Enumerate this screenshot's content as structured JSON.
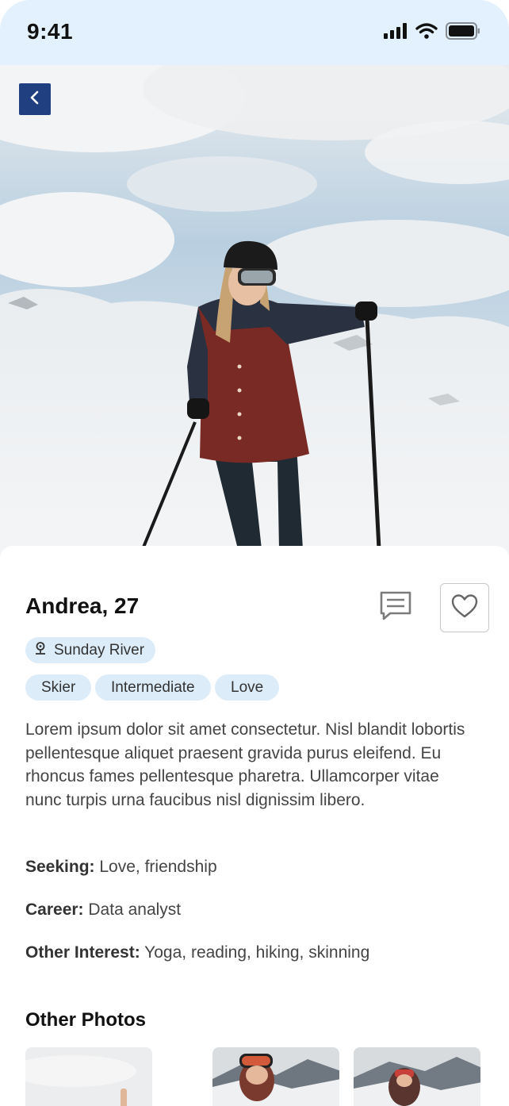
{
  "status_bar": {
    "time": "9:41",
    "icons": [
      "signal-icon",
      "wifi-icon",
      "battery-icon"
    ]
  },
  "hero": {
    "photo": "skier-in-snow-photo",
    "back_icon": "chevron-left-icon"
  },
  "profile": {
    "name": "Andrea, 27",
    "location": "Sunday River",
    "tags": [
      "Skier",
      "Intermediate",
      "Love"
    ],
    "bio": "Lorem ipsum dolor sit amet consectetur. Nisl blandit lobortis pellentesque aliquet praesent gravida purus eleifend. Eu rhoncus fames pellentesque pharetra. Ullamcorper vitae nunc turpis urna faucibus nisl dignissim libero.",
    "details": [
      {
        "label": "Seeking:",
        "value": "Love, friendship"
      },
      {
        "label": "Career:",
        "value": "Data analyst"
      },
      {
        "label": "Other Interest:",
        "value": "Yoga, reading, hiking, skinning"
      }
    ]
  },
  "actions": {
    "message_icon": "message-icon",
    "favorite_icon": "heart-icon"
  },
  "other_photos": {
    "title": "Other Photos"
  },
  "colors": {
    "status_bg": "#e3f0fd",
    "accent": "#1f3f80",
    "chip_bg": "#dcecf9"
  }
}
